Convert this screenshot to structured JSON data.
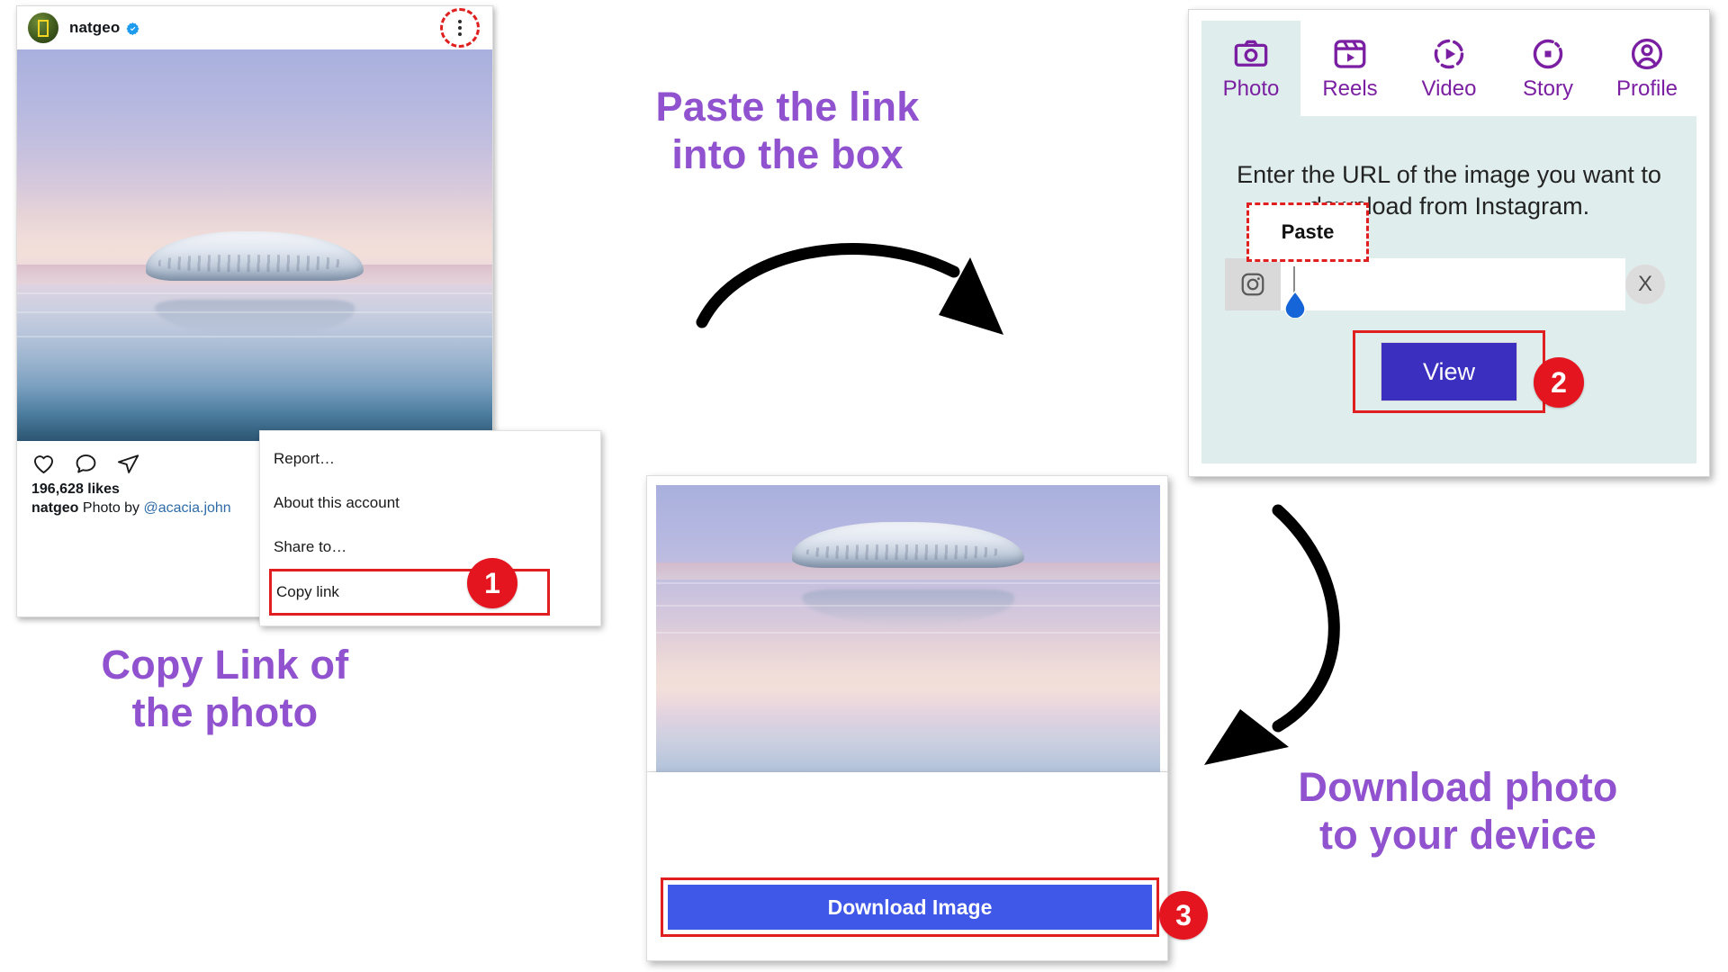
{
  "instagram_post": {
    "username": "natgeo",
    "verified_icon": "verified-badge-icon",
    "avatar_icon": "natgeo-avatar",
    "menu_icon": "three-dots-vertical-icon",
    "actions": {
      "like_icon": "heart-icon",
      "comment_icon": "comment-bubble-icon",
      "share_icon": "paper-plane-icon"
    },
    "likes": "196,628 likes",
    "caption_user": "natgeo",
    "caption_text": " Photo by ",
    "caption_mention": "@acacia.john"
  },
  "context_menu": {
    "items": [
      {
        "label": "Report…",
        "highlighted": false
      },
      {
        "label": "About this account",
        "highlighted": false
      },
      {
        "label": "Share to…",
        "highlighted": false
      },
      {
        "label": "Copy link",
        "highlighted": true
      }
    ]
  },
  "steps": {
    "one": "1",
    "two": "2",
    "three": "3"
  },
  "annotations": {
    "paste_link": "Paste the link\ninto the box",
    "copy_link": "Copy Link of\nthe photo",
    "download_photo": "Download photo\nto your device",
    "arrow_1_icon": "curved-arrow-right-icon",
    "arrow_2_icon": "curved-arrow-down-left-icon"
  },
  "downloader_panel": {
    "tabs": [
      {
        "label": "Photo",
        "icon": "camera-icon",
        "active": true
      },
      {
        "label": "Reels",
        "icon": "reels-icon",
        "active": false
      },
      {
        "label": "Video",
        "icon": "video-play-icon",
        "active": false
      },
      {
        "label": "Story",
        "icon": "story-circle-icon",
        "active": false
      },
      {
        "label": "Profile",
        "icon": "profile-icon",
        "active": false
      }
    ],
    "instruction": "Enter the URL of the image you want to download from Instagram.",
    "paste_tooltip": "Paste",
    "url_input": {
      "value": "",
      "placeholder": "",
      "prefix_icon": "instagram-icon",
      "clear_label": "X",
      "cursor_handle_icon": "text-selection-handle-icon"
    },
    "view_button": "View"
  },
  "preview_card": {
    "download_button": "Download Image"
  },
  "colors": {
    "accent_purple": "#9152cf",
    "tab_purple": "#7b1fa2",
    "tab_active_bg": "#dfeeed",
    "highlight_red": "#e02020",
    "badge_red": "#e4151f",
    "view_button_blue": "#3b2fbf",
    "download_button_blue": "#4058e8",
    "verified_blue": "#1d9bf0",
    "handle_blue": "#1565d8"
  }
}
